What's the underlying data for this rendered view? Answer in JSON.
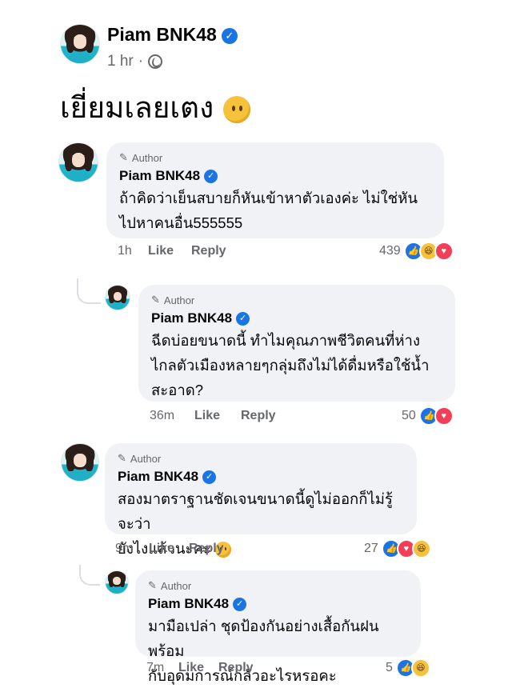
{
  "post": {
    "author": "Piam BNK48",
    "time": "1 hr",
    "separator": "·",
    "text": "เยี่ยมเลยเตง"
  },
  "comments": [
    {
      "badge": "Author",
      "name": "Piam BNK48",
      "line1": "ถ้าคิดว่าเย็นสบายก็หันเข้าหาตัวเองค่ะ ไม่ใช่หัน",
      "line2": "ไปหาคนอื่น555555",
      "time": "1h",
      "like": "Like",
      "reply": "Reply",
      "count": "439",
      "reactions": [
        "like",
        "haha",
        "love"
      ]
    },
    {
      "badge": "Author",
      "name": "Piam BNK48",
      "line1": "ฉีดบ่อยขนาดนี้ ทำไมคุณภาพชีวิตคนที่ห่าง",
      "line2": "ไกลตัวเมืองหลายๆกลุ่มถึงไม่ได้ดื่มหรือใช้น้ำ",
      "line3": "สะอาด?",
      "time": "36m",
      "like": "Like",
      "reply": "Reply",
      "count": "50",
      "reactions": [
        "like",
        "love"
      ]
    },
    {
      "badge": "Author",
      "name": "Piam BNK48",
      "line1": "สองมาตราฐานชัดเจนขนาดนี้ดูไม่ออกก็ไม่รู้จะว่า",
      "line2": "ยังไงแล้วนะคะ",
      "time": "9m",
      "like": "Like",
      "reply": "Reply",
      "count": "27",
      "reactions": [
        "like",
        "love",
        "haha"
      ]
    },
    {
      "badge": "Author",
      "name": "Piam BNK48",
      "line1": "มามือเปล่า ชุดป้องกันอย่างเสื้อกันฝน พร้อม",
      "line2": "กับอุดมการณ์กลัวอะไรหรอคะ",
      "time": "7m",
      "like": "Like",
      "reply": "Reply",
      "count": "5",
      "reactions": [
        "like",
        "haha"
      ]
    }
  ]
}
